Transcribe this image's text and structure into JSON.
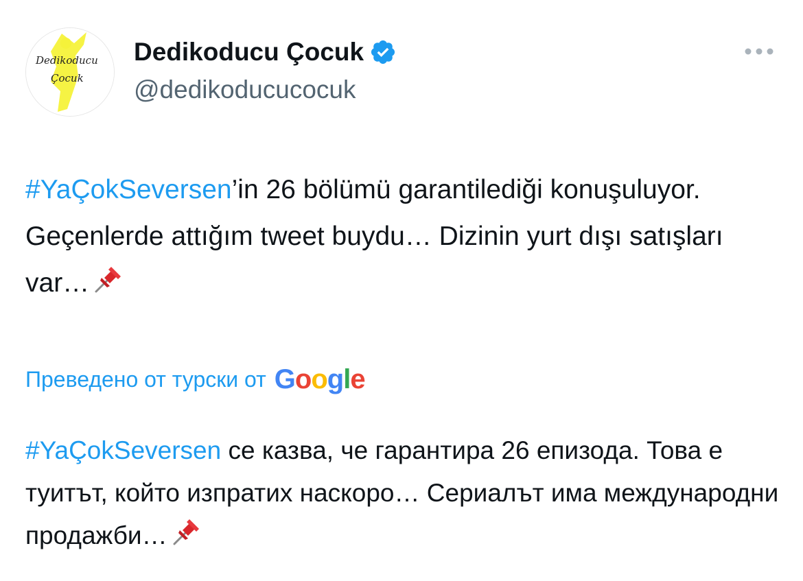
{
  "account": {
    "display_name": "Dedikoducu Çocuk",
    "handle": "@dedikoducucocuk",
    "verified": true,
    "avatar_text_line1": "Dedikoducu",
    "avatar_text_line2": "Çocuk"
  },
  "tweet": {
    "hashtag": "#YaÇokSeversen",
    "text_after_hashtag": "’in 26 bölümü garantilediği konuşuluyor. Geçenlerde attığım tweet buydu… Dizinin yurt dışı satışları var…",
    "emoji": "pushpin"
  },
  "translation": {
    "label": "Преведено от турски от",
    "provider": "Google",
    "hashtag": "#YaÇokSeversen",
    "text_after_hashtag": " се казва, че гарантира 26 епизода. Това е туитът, който изпратих наскоро… Сериалът има международни продажби…",
    "emoji": "pushpin"
  },
  "colors": {
    "link": "#1d9bf0",
    "text": "#0f1419",
    "secondary": "#536471",
    "verified": "#1d9bf0",
    "avatar_yellow": "#f5f23a"
  },
  "icons": {
    "more": "more-dots-icon",
    "verified": "verified-badge-icon",
    "pin": "pushpin-emoji-icon"
  }
}
